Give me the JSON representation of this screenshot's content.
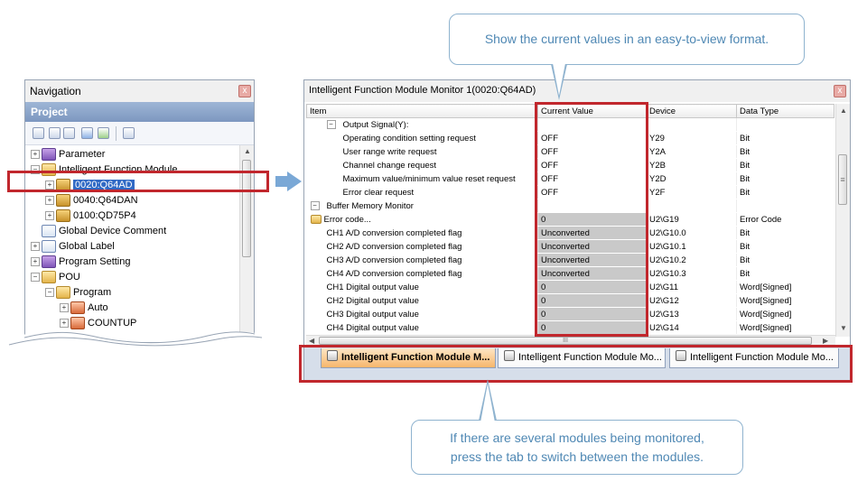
{
  "callouts": {
    "top": "Show the current values in an easy-to-view format.",
    "bottom_line1": "If there are several modules being monitored,",
    "bottom_line2": "press the tab to switch between the modules."
  },
  "navigation": {
    "title": "Navigation",
    "close": "x",
    "project_header": "Project",
    "tree": [
      {
        "label": "Parameter",
        "expander": "+",
        "icon": "parameter-icon"
      },
      {
        "label": "Intelligent Function Module",
        "expander": "−",
        "icon": "folder-icon"
      },
      {
        "label": "0020:Q64AD",
        "expander": "+",
        "icon": "module-icon",
        "selected": true
      },
      {
        "label": "0040:Q64DAN",
        "expander": "+",
        "icon": "module-icon"
      },
      {
        "label": "0100:QD75P4",
        "expander": "+",
        "icon": "module-icon"
      },
      {
        "label": "Global Device Comment",
        "expander": "",
        "icon": "comment-icon"
      },
      {
        "label": "Global Label",
        "expander": "+",
        "icon": "label-icon"
      },
      {
        "label": "Program Setting",
        "expander": "+",
        "icon": "setting-icon"
      },
      {
        "label": "POU",
        "expander": "−",
        "icon": "folder-icon"
      },
      {
        "label": "Program",
        "expander": "−",
        "icon": "folder-icon"
      },
      {
        "label": "Auto",
        "expander": "+",
        "icon": "program-icon"
      },
      {
        "label": "COUNTUP",
        "expander": "+",
        "icon": "program-icon"
      }
    ]
  },
  "monitor": {
    "title": "Intelligent Function Module Monitor 1(0020:Q64AD)",
    "close": "x",
    "columns": [
      "Item",
      "Current Value",
      "Device",
      "Data Type"
    ],
    "rows": [
      {
        "item": "Output Signal(Y):",
        "value": "",
        "device": "",
        "type": "",
        "level": 1,
        "group": true,
        "grey": false
      },
      {
        "item": "Operating condition setting request",
        "value": "OFF",
        "device": "Y29",
        "type": "Bit",
        "level": 2,
        "grey": false
      },
      {
        "item": "User range write request",
        "value": "OFF",
        "device": "Y2A",
        "type": "Bit",
        "level": 2,
        "grey": false
      },
      {
        "item": "Channel change request",
        "value": "OFF",
        "device": "Y2B",
        "type": "Bit",
        "level": 2,
        "grey": false
      },
      {
        "item": "Maximum value/minimum value reset request",
        "value": "OFF",
        "device": "Y2D",
        "type": "Bit",
        "level": 2,
        "grey": false
      },
      {
        "item": "Error clear request",
        "value": "OFF",
        "device": "Y2F",
        "type": "Bit",
        "level": 2,
        "grey": false
      },
      {
        "item": "Buffer Memory Monitor",
        "value": "",
        "device": "",
        "type": "",
        "level": 0,
        "group": true,
        "grey": false
      },
      {
        "item": "Error code...",
        "value": "0",
        "device": "U2\\G19",
        "type": "Error Code",
        "level": 0,
        "folder": true,
        "grey": true
      },
      {
        "item": "CH1 A/D conversion completed flag",
        "value": "Unconverted",
        "device": "U2\\G10.0",
        "type": "Bit",
        "level": 1,
        "grey": true
      },
      {
        "item": "CH2 A/D conversion completed flag",
        "value": "Unconverted",
        "device": "U2\\G10.1",
        "type": "Bit",
        "level": 1,
        "grey": true
      },
      {
        "item": "CH3 A/D conversion completed flag",
        "value": "Unconverted",
        "device": "U2\\G10.2",
        "type": "Bit",
        "level": 1,
        "grey": true
      },
      {
        "item": "CH4 A/D conversion completed flag",
        "value": "Unconverted",
        "device": "U2\\G10.3",
        "type": "Bit",
        "level": 1,
        "grey": true
      },
      {
        "item": "CH1 Digital output value",
        "value": "0",
        "device": "U2\\G11",
        "type": "Word[Signed]",
        "level": 1,
        "grey": true
      },
      {
        "item": "CH2 Digital output value",
        "value": "0",
        "device": "U2\\G12",
        "type": "Word[Signed]",
        "level": 1,
        "grey": true
      },
      {
        "item": "CH3 Digital output value",
        "value": "0",
        "device": "U2\\G13",
        "type": "Word[Signed]",
        "level": 1,
        "grey": true
      },
      {
        "item": "CH4 Digital output value",
        "value": "0",
        "device": "U2\\G14",
        "type": "Word[Signed]",
        "level": 1,
        "grey": true
      }
    ],
    "scroll_grip": "≡",
    "hscroll_grip": "III"
  },
  "tabs": [
    {
      "label": "Intelligent Function Module M...",
      "active": true
    },
    {
      "label": "Intelligent Function Module Mo...",
      "active": false
    },
    {
      "label": "Intelligent Function Module Mo...",
      "active": false
    }
  ],
  "colors": {
    "highlight_red": "#c1272d",
    "callout_text": "#4f88b4",
    "arrow": "#7aa8d6",
    "selection": "#316ac5"
  }
}
